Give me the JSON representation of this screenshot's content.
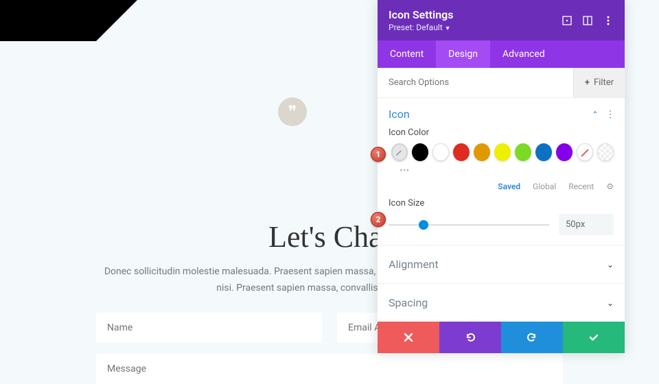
{
  "page": {
    "headline": "Let's Chat",
    "subtext": "Donec sollicitudin molestie malesuada. Praesent sapien massa, convallis a pellentesque nec, egestas non nisi. Praesent sapien massa, convallis a pellentesque",
    "name_placeholder": "Name",
    "email_placeholder": "Email Address",
    "message_placeholder": "Message"
  },
  "panel": {
    "title": "Icon Settings",
    "preset_label": "Preset: Default",
    "tabs": {
      "content": "Content",
      "design": "Design",
      "advanced": "Advanced"
    },
    "search_placeholder": "Search Options",
    "filter_label": "Filter",
    "section_icon": {
      "title": "Icon",
      "color_label": "Icon Color",
      "color_tabs": {
        "saved": "Saved",
        "global": "Global",
        "recent": "Recent"
      },
      "size_label": "Icon Size",
      "size_value": "50px",
      "swatches": [
        "#000000",
        "#ffffff",
        "#e02b20",
        "#e09900",
        "#edf000",
        "#7cda24",
        "#0c71c3",
        "#8300e9"
      ]
    },
    "section_alignment": {
      "title": "Alignment"
    },
    "section_spacing": {
      "title": "Spacing"
    }
  },
  "callouts": {
    "c1": "1",
    "c2": "2"
  }
}
